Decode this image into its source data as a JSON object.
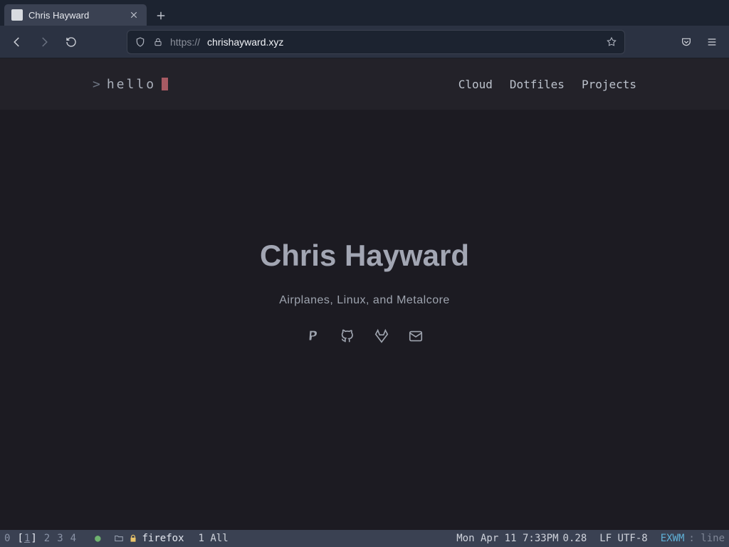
{
  "browser": {
    "tab_title": "Chris Hayward",
    "url_protocol": "https://",
    "url_host": "chrishayward.xyz"
  },
  "site": {
    "brand_prompt": ">",
    "brand_word": "hello",
    "nav": [
      "Cloud",
      "Dotfiles",
      "Projects"
    ]
  },
  "hero": {
    "title": "Chris Hayward",
    "tagline": "Airplanes, Linux, and Metalcore",
    "socials": [
      "paypal",
      "github",
      "gitlab",
      "mail"
    ]
  },
  "modeline": {
    "workspaces": [
      "0",
      "1",
      "2",
      "3",
      "4"
    ],
    "current_workspace": "1",
    "buffer": "firefox",
    "line_info": "1 All",
    "clock": "Mon Apr 11 7:33PM",
    "load": "0.28",
    "encoding": "LF UTF-8",
    "major_mode": "EXWM",
    "minor": ": line"
  }
}
